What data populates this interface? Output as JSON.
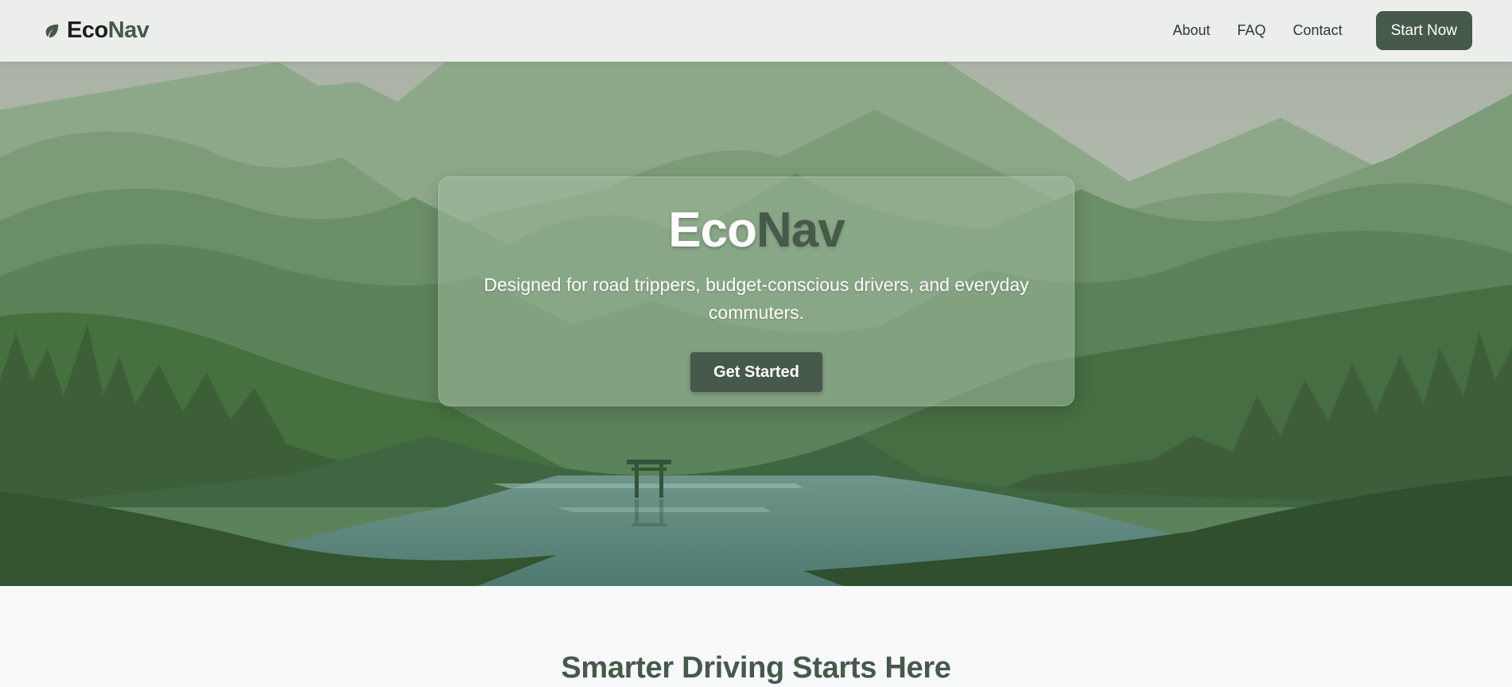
{
  "header": {
    "brand": {
      "part1": "Eco",
      "part2": "Nav",
      "icon": "leaf-icon"
    },
    "nav": [
      {
        "label": "About"
      },
      {
        "label": "FAQ"
      },
      {
        "label": "Contact"
      }
    ],
    "cta_label": "Start Now"
  },
  "hero": {
    "title_part1": "Eco",
    "title_part2": "Nav",
    "subtitle": "Designed for road trippers, budget-conscious drivers, and everyday commuters.",
    "button_label": "Get Started"
  },
  "section": {
    "title": "Smarter Driving Starts Here"
  },
  "colors": {
    "primary": "#46594a",
    "header_bg": "#eceeeb",
    "page_bg": "#f7f9fa",
    "text_dark": "#1c1f1c"
  }
}
